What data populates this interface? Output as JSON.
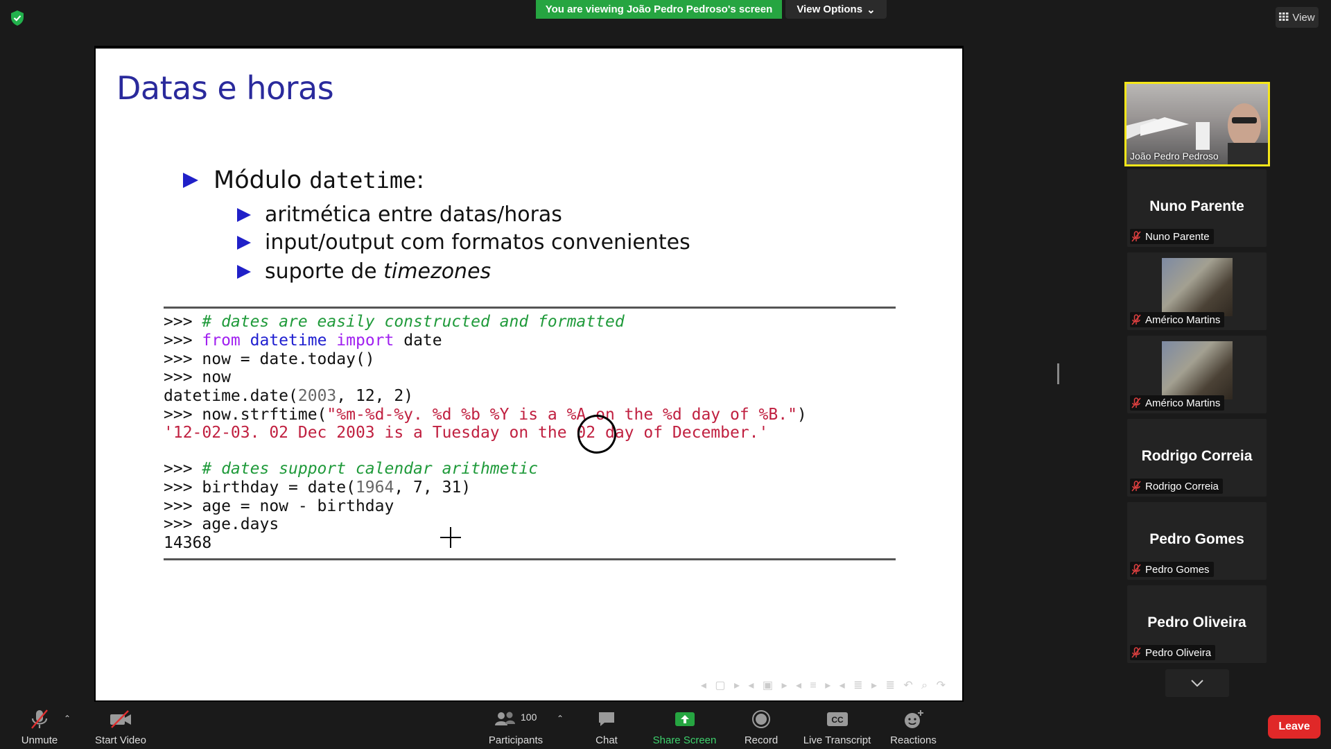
{
  "banner": {
    "text": "You are viewing João Pedro Pedroso's screen"
  },
  "view_options": {
    "label": "View Options"
  },
  "view_button": {
    "label": "View"
  },
  "slide": {
    "title": "Datas e horas",
    "bullet_main_prefix": "Módulo ",
    "bullet_main_mono": "datetime",
    "bullet_main_suffix": ":",
    "sub1": "aritmética entre datas/horas",
    "sub2": "input/output com formatos convenientes",
    "sub3_prefix": "suporte de ",
    "sub3_em": "timezones",
    "code": {
      "l1_prompt": ">>> ",
      "l1_comment": "# dates are easily constructed and formatted",
      "l2_prompt": ">>> ",
      "l2_from": "from",
      "l2_mod": "datetime",
      "l2_import": "import",
      "l2_name": "date",
      "l3": ">>> now = date.today()",
      "l4": ">>> now",
      "l5_a": "datetime.date(",
      "l5_b": "2003",
      "l5_c": ", ",
      "l5_d": "12",
      "l5_e": ", ",
      "l5_f": "2",
      "l5_g": ")",
      "l6_a": ">>> now.strftime(",
      "l6_b": "\"%m-%d-%y. %d %b %Y is a %A on the %d day of %B.\"",
      "l6_c": ")",
      "l7": "'12-02-03. 02 Dec 2003 is a Tuesday on the 02 day of December.'",
      "l8_prompt": ">>> ",
      "l8_comment": "# dates support calendar arithmetic",
      "l9_a": ">>> birthday = date(",
      "l9_b": "1964",
      "l9_c": ", ",
      "l9_d": "7",
      "l9_e": ", ",
      "l9_f": "31",
      "l9_g": ")",
      "l10": ">>> age = now - birthday",
      "l11": ">>> age.days",
      "l12": "14368"
    },
    "nav_symbols": "◂ ▢ ▸ ◂ ▣ ▸ ◂ ≡ ▸ ◂ ≣ ▸ ≣ ↶ ⌕ ↷"
  },
  "participants_panel": {
    "active": {
      "name": "João Pedro Pedroso"
    },
    "tiles": [
      {
        "big": "Nuno Parente",
        "label": "Nuno Parente",
        "photo": false
      },
      {
        "big": "",
        "label": "Américo Martins",
        "photo": true
      },
      {
        "big": "",
        "label": "Américo Martins",
        "photo": true
      },
      {
        "big": "Rodrigo Correia",
        "label": "Rodrigo Correia",
        "photo": false
      },
      {
        "big": "Pedro Gomes",
        "label": "Pedro Gomes",
        "photo": false
      },
      {
        "big": "Pedro Oliveira",
        "label": "Pedro Oliveira",
        "photo": false
      }
    ]
  },
  "toolbar": {
    "unmute": "Unmute",
    "start_video": "Start Video",
    "participants": "Participants",
    "participants_count": "100",
    "chat": "Chat",
    "share_screen": "Share Screen",
    "record": "Record",
    "live_transcript": "Live Transcript",
    "cc": "CC",
    "reactions": "Reactions",
    "leave": "Leave"
  },
  "colors": {
    "share_green": "#26a541",
    "leave_red": "#e02828",
    "active_border": "#f5e61a"
  }
}
